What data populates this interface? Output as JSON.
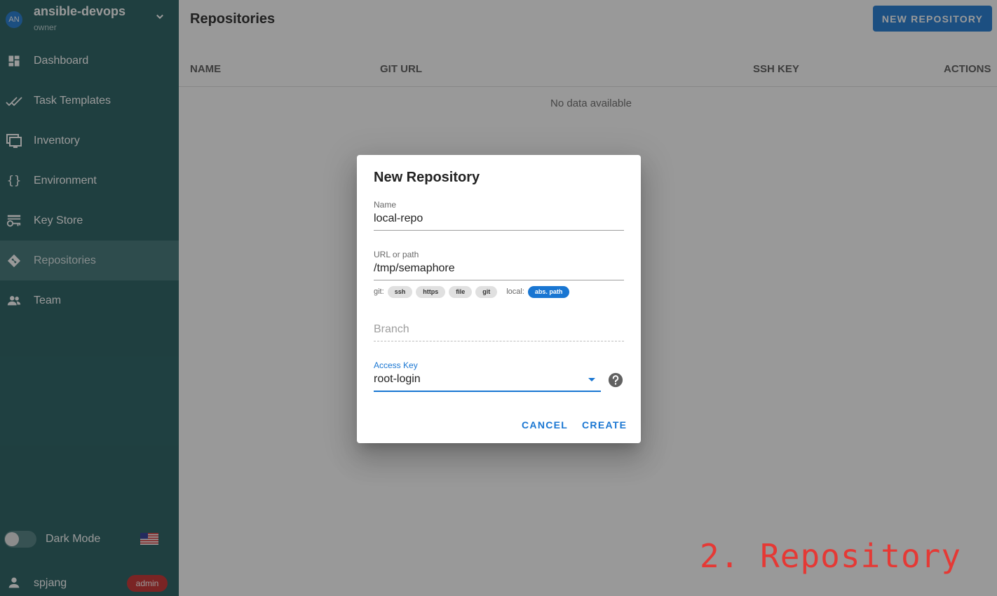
{
  "sidebar": {
    "project": {
      "avatar": "AN",
      "name": "ansible-devops",
      "role": "owner",
      "chevron_icon": "chevron-down-icon"
    },
    "items": [
      {
        "label": "Dashboard",
        "icon": "dashboard-icon",
        "active": false
      },
      {
        "label": "Task Templates",
        "icon": "double-check-icon",
        "active": false
      },
      {
        "label": "Inventory",
        "icon": "monitor-icon",
        "active": false
      },
      {
        "label": "Environment",
        "icon": "braces-icon",
        "active": false
      },
      {
        "label": "Key Store",
        "icon": "key-icon",
        "active": false
      },
      {
        "label": "Repositories",
        "icon": "git-icon",
        "active": true
      },
      {
        "label": "Team",
        "icon": "team-icon",
        "active": false
      }
    ],
    "dark_mode_label": "Dark Mode",
    "dark_mode_on": false,
    "flag_icon": "us-flag-icon",
    "user": {
      "name": "spjang",
      "badge": "admin",
      "icon": "user-icon"
    }
  },
  "main": {
    "title": "Repositories",
    "new_button": "NEW REPOSITORY",
    "columns": [
      "NAME",
      "GIT URL",
      "SSH KEY",
      "ACTIONS"
    ],
    "empty_text": "No data available"
  },
  "dialog": {
    "title": "New Repository",
    "name_label": "Name",
    "name_value": "local-repo",
    "url_label": "URL or path",
    "url_value": "/tmp/semaphore",
    "git_prefix": "git:",
    "git_chips": [
      "ssh",
      "https",
      "file",
      "git"
    ],
    "local_prefix": "local:",
    "local_chip": "abs. path",
    "branch_placeholder": "Branch",
    "access_key_label": "Access Key",
    "access_key_value": "root-login",
    "help_icon": "help-icon",
    "cancel_label": "CANCEL",
    "create_label": "CREATE"
  },
  "caption": "2. Repository",
  "colors": {
    "sidebar": "#1e5a5c",
    "primary": "#1976d2",
    "badge": "#c62828",
    "caption": "#e53935"
  }
}
